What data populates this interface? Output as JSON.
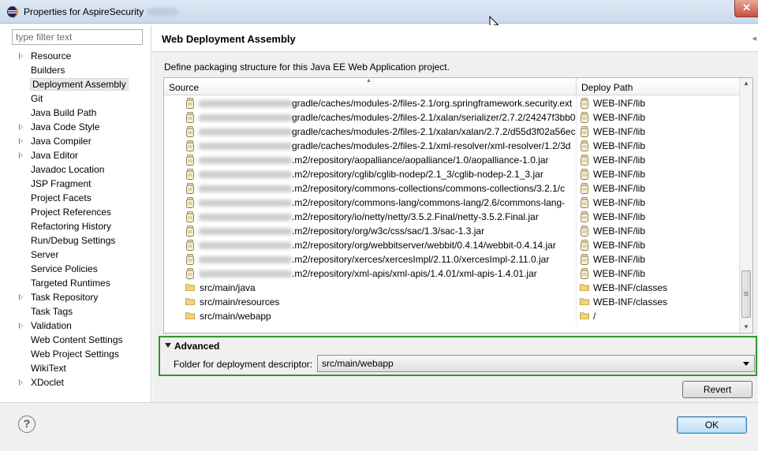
{
  "window": {
    "title": "Properties for AspireSecurity"
  },
  "filter": {
    "placeholder": "type filter text"
  },
  "tree": [
    {
      "label": "Resource",
      "expandable": true
    },
    {
      "label": "Builders",
      "expandable": false
    },
    {
      "label": "Deployment Assembly",
      "expandable": false,
      "selected": true
    },
    {
      "label": "Git",
      "expandable": false
    },
    {
      "label": "Java Build Path",
      "expandable": false
    },
    {
      "label": "Java Code Style",
      "expandable": true
    },
    {
      "label": "Java Compiler",
      "expandable": true
    },
    {
      "label": "Java Editor",
      "expandable": true
    },
    {
      "label": "Javadoc Location",
      "expandable": false
    },
    {
      "label": "JSP Fragment",
      "expandable": false
    },
    {
      "label": "Project Facets",
      "expandable": false
    },
    {
      "label": "Project References",
      "expandable": false
    },
    {
      "label": "Refactoring History",
      "expandable": false
    },
    {
      "label": "Run/Debug Settings",
      "expandable": false
    },
    {
      "label": "Server",
      "expandable": false
    },
    {
      "label": "Service Policies",
      "expandable": false
    },
    {
      "label": "Targeted Runtimes",
      "expandable": false
    },
    {
      "label": "Task Repository",
      "expandable": true
    },
    {
      "label": "Task Tags",
      "expandable": false
    },
    {
      "label": "Validation",
      "expandable": true
    },
    {
      "label": "Web Content Settings",
      "expandable": false
    },
    {
      "label": "Web Project Settings",
      "expandable": false
    },
    {
      "label": "WikiText",
      "expandable": false
    },
    {
      "label": "XDoclet",
      "expandable": true
    }
  ],
  "page": {
    "title": "Web Deployment Assembly",
    "description": "Define packaging structure for this Java EE Web Application project."
  },
  "table": {
    "columns": {
      "source": "Source",
      "deploy": "Deploy Path"
    },
    "rows": [
      {
        "type": "jar",
        "source": "gradle/caches/modules-2/files-2.1/org.springframework.security.ext",
        "deploy": "WEB-INF/lib"
      },
      {
        "type": "jar",
        "source": "gradle/caches/modules-2/files-2.1/xalan/serializer/2.7.2/24247f3bb05",
        "deploy": "WEB-INF/lib"
      },
      {
        "type": "jar",
        "source": "gradle/caches/modules-2/files-2.1/xalan/xalan/2.7.2/d55d3f02a56ec",
        "deploy": "WEB-INF/lib"
      },
      {
        "type": "jar",
        "source": "gradle/caches/modules-2/files-2.1/xml-resolver/xml-resolver/1.2/3d",
        "deploy": "WEB-INF/lib"
      },
      {
        "type": "jar",
        "source": ".m2/repository/aopalliance/aopalliance/1.0/aopalliance-1.0.jar",
        "deploy": "WEB-INF/lib"
      },
      {
        "type": "jar",
        "source": ".m2/repository/cglib/cglib-nodep/2.1_3/cglib-nodep-2.1_3.jar",
        "deploy": "WEB-INF/lib"
      },
      {
        "type": "jar",
        "source": ".m2/repository/commons-collections/commons-collections/3.2.1/c",
        "deploy": "WEB-INF/lib"
      },
      {
        "type": "jar",
        "source": ".m2/repository/commons-lang/commons-lang/2.6/commons-lang-",
        "deploy": "WEB-INF/lib"
      },
      {
        "type": "jar",
        "source": ".m2/repository/io/netty/netty/3.5.2.Final/netty-3.5.2.Final.jar",
        "deploy": "WEB-INF/lib"
      },
      {
        "type": "jar",
        "source": ".m2/repository/org/w3c/css/sac/1.3/sac-1.3.jar",
        "deploy": "WEB-INF/lib"
      },
      {
        "type": "jar",
        "source": ".m2/repository/org/webbitserver/webbit/0.4.14/webbit-0.4.14.jar",
        "deploy": "WEB-INF/lib"
      },
      {
        "type": "jar",
        "source": ".m2/repository/xerces/xercesImpl/2.11.0/xercesImpl-2.11.0.jar",
        "deploy": "WEB-INF/lib"
      },
      {
        "type": "jar",
        "source": ".m2/repository/xml-apis/xml-apis/1.4.01/xml-apis-1.4.01.jar",
        "deploy": "WEB-INF/lib"
      },
      {
        "type": "folder",
        "source": "src/main/java",
        "deploy": "WEB-INF/classes"
      },
      {
        "type": "folder",
        "source": "src/main/resources",
        "deploy": "WEB-INF/classes"
      },
      {
        "type": "folder",
        "source": "src/main/webapp",
        "deploy": "/"
      }
    ]
  },
  "advanced": {
    "title": "Advanced",
    "descriptor_label": "Folder for deployment descriptor:",
    "descriptor_value": "src/main/webapp"
  },
  "buttons": {
    "revert": "Revert",
    "ok": "OK",
    "help": "?"
  },
  "colors": {
    "highlight_border": "#2b9a2b",
    "ok_border": "#3c7fb1"
  }
}
